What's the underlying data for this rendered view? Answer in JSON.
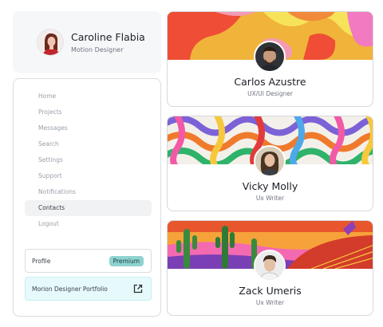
{
  "user": {
    "name": "Caroline Flabia",
    "role": "Motion Designer"
  },
  "nav": [
    "Home",
    "Projects",
    "Messages",
    "Search",
    "Settings",
    "Support",
    "Notifications",
    "Contacts",
    "Logout"
  ],
  "active_nav": "Contacts",
  "profile_row": {
    "label": "Profile",
    "badge": "Premium"
  },
  "portfolio_link": {
    "label": "Morion Designer Portfolio",
    "icon": "external-link-icon"
  },
  "contacts": [
    {
      "name": "Carlos Azustre",
      "role": "UX/UI Designer"
    },
    {
      "name": "Vicky Molly",
      "role": "Ux Writer"
    },
    {
      "name": "Zack Umeris",
      "role": "Ux Writer"
    }
  ],
  "colors": {
    "accent_badge": "#8ed3d1",
    "link_bg": "#e7fafb",
    "sidebar_border": "#d9dce1"
  }
}
